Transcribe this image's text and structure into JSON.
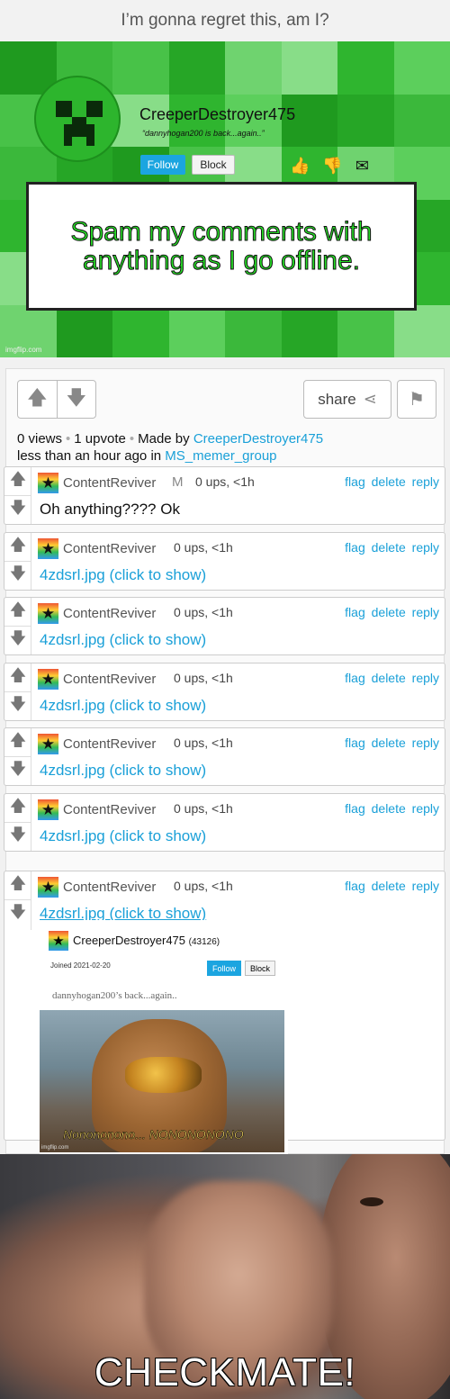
{
  "top_caption": "I’m gonna regret this, am I?",
  "announcement": {
    "username": "CreeperDestroyer475",
    "bio": "“dannyhogan200 is back...again..”",
    "follow_label": "Follow",
    "block_label": "Block",
    "message": "Spam my comments with anything as I go offline.",
    "watermark": "imgflip.com",
    "colors": {
      "green_light": "#5ccf5c",
      "green_dark": "#1f9a1f",
      "text": "#27e027"
    }
  },
  "post": {
    "share_label": "share",
    "views": "0 views",
    "upvotes": "1 upvote",
    "made_by_prefix": "Made by",
    "author": "CreeperDestroyer475",
    "time_prefix": "less than an hour ago in",
    "group": "MS_memer_group"
  },
  "comments": [
    {
      "user": "ContentReviver",
      "mod": "M",
      "ups": "0 ups, <1h",
      "actions": "flag delete reply",
      "body": "Oh anything???? Ok"
    },
    {
      "user": "ContentReviver",
      "ups": "0 ups, <1h",
      "actions": "flag delete reply",
      "body": "4zdsrl.jpg (click to show)"
    },
    {
      "user": "ContentReviver",
      "ups": "0 ups, <1h",
      "actions": "flag delete reply",
      "body": "4zdsrl.jpg (click to show)"
    },
    {
      "user": "ContentReviver",
      "ups": "0 ups, <1h",
      "actions": "flag delete reply",
      "body": "4zdsrl.jpg (click to show)"
    },
    {
      "user": "ContentReviver",
      "ups": "0 ups, <1h",
      "actions": "flag delete reply",
      "body": "4zdsrl.jpg (click to show)"
    },
    {
      "user": "ContentReviver",
      "ups": "0 ups, <1h",
      "actions": "flag delete reply",
      "body": "4zdsrl.jpg (click to show)"
    },
    {
      "user": "ContentReviver",
      "ups": "0 ups, <1h",
      "actions": "flag delete reply",
      "body": "4zdsrl.jpg (click to show)"
    }
  ],
  "embed": {
    "username": "CreeperDestroyer475",
    "score": "(43126)",
    "joined": "Joined 2021-02-20",
    "follow_label": "Follow",
    "block_label": "Block",
    "bio": "dannyhogan200’s back...again..",
    "image_caption": "Nonononono... NONONONONO",
    "watermark": "imgflip.com"
  },
  "meme": {
    "caption": "CHECKMATE!"
  }
}
